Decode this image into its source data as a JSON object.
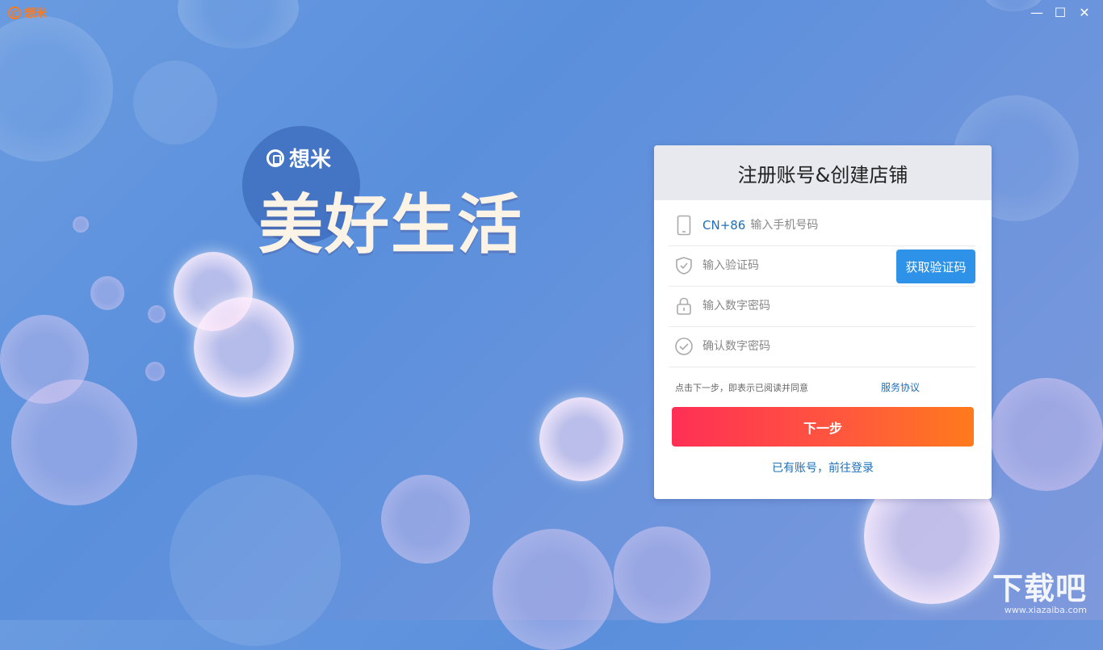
{
  "window": {
    "app_name": "想米",
    "minimize_glyph": "—",
    "maximize_glyph": "☐",
    "close_glyph": "✕"
  },
  "hero": {
    "brand": "想米",
    "slogan": "美好生活"
  },
  "register": {
    "title": "注册账号&创建店铺",
    "country_code": "CN+86",
    "phone_placeholder": "输入手机号码",
    "code_placeholder": "输入验证码",
    "get_code_label": "获取验证码",
    "password_placeholder": "输入数字密码",
    "confirm_placeholder": "确认数字密码",
    "agreement_text": "点击下一步，即表示已阅读并同意",
    "agreement_link": "服务协议",
    "next_label": "下一步",
    "login_link": "已有账号，前往登录"
  },
  "icons": {
    "app": "logo-icon",
    "phone": "phone-icon",
    "code": "shield-check-icon",
    "password": "lock-icon",
    "confirm": "check-circle-icon"
  },
  "colors": {
    "accent_blue": "#2e93e8",
    "link_blue": "#1e6fb8",
    "brand_orange": "#ff7a1a",
    "gradient_start": "#ff2f55",
    "gradient_end": "#ff7a1c"
  },
  "watermark": {
    "text": "下载吧",
    "url": "www.xiazaiba.com"
  }
}
